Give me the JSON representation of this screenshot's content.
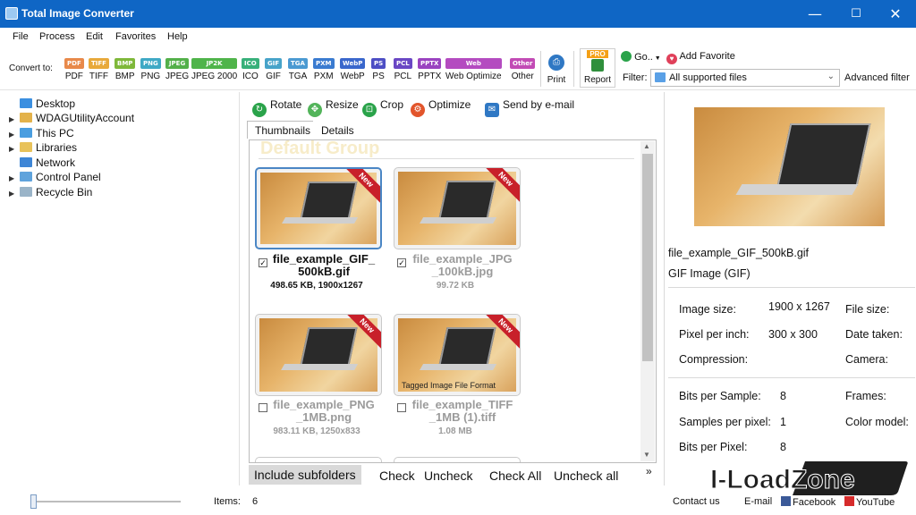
{
  "window": {
    "title": "Total Image Converter",
    "minimize": "—",
    "maximize": "☐",
    "close": "✕"
  },
  "menu": [
    "File",
    "Process",
    "Edit",
    "Favorites",
    "Help"
  ],
  "toolbar": {
    "convert_to": "Convert to:",
    "formats": [
      {
        "chip": "PDF",
        "label": "PDF",
        "color": "#e8894a"
      },
      {
        "chip": "TIFF",
        "label": "TIFF",
        "color": "#e8a93a"
      },
      {
        "chip": "BMP",
        "label": "BMP",
        "color": "#7fb83a"
      },
      {
        "chip": "PNG",
        "label": "PNG",
        "color": "#3fa9c5"
      },
      {
        "chip": "JPEG",
        "label": "JPEG",
        "color": "#53b04a"
      },
      {
        "chip": "JP2K",
        "label": "JPEG 2000",
        "color": "#4fb44a"
      },
      {
        "chip": "ICO",
        "label": "ICO",
        "color": "#38b07a"
      },
      {
        "chip": "GIF",
        "label": "GIF",
        "color": "#47a3c9"
      },
      {
        "chip": "TGA",
        "label": "TGA",
        "color": "#4b9ad2"
      },
      {
        "chip": "PXM",
        "label": "PXM",
        "color": "#3a7bd0"
      },
      {
        "chip": "WebP",
        "label": "WebP",
        "color": "#3a67cc"
      },
      {
        "chip": "PS",
        "label": "PS",
        "color": "#4d4ec4"
      },
      {
        "chip": "PCL",
        "label": "PCL",
        "color": "#6a47c4"
      },
      {
        "chip": "PPTX",
        "label": "PPTX",
        "color": "#9a43c0"
      },
      {
        "chip": "Web",
        "label": "Web Optimize",
        "color": "#b44bc0"
      },
      {
        "chip": "Other",
        "label": "Other",
        "color": "#c24bb5"
      }
    ],
    "print": "Print",
    "pro_badge": "PRO",
    "report": "Report",
    "go": "Go..",
    "add_favorite": "Add Favorite",
    "filter_label": "Filter:",
    "filter_value": "All supported files",
    "advanced_filter": "Advanced filter"
  },
  "tree": [
    "Desktop",
    "WDAGUtilityAccount",
    "This PC",
    "Libraries",
    "Network",
    "Control Panel",
    "Recycle Bin"
  ],
  "actions": [
    "Rotate",
    "Resize",
    "Crop",
    "Optimize",
    "Send by e-mail"
  ],
  "tabs": [
    "Thumbnails",
    "Details"
  ],
  "group_title": "Default Group",
  "ribbon": "New",
  "thumbnails": [
    {
      "line1": "file_example_GIF_",
      "line2": "500kB.gif",
      "meta": "498.65 KB, 1900x1267",
      "checked": true
    },
    {
      "line1": "file_example_JPG",
      "line2": "_100kB.jpg",
      "meta": "99.72 KB",
      "checked": true
    },
    {
      "line1": "file_example_PNG",
      "line2": "_1MB.png",
      "meta": "983.11 KB, 1250x833",
      "checked": false
    },
    {
      "line1": "file_example_TIFF",
      "line2": "_1MB (1).tiff",
      "meta": "1.08 MB",
      "checked": false,
      "overlay": "Tagged Image File Format"
    }
  ],
  "bottom_bar": {
    "include": "Include subfolders",
    "check": "Check",
    "uncheck": "Uncheck",
    "check_all": "Check All",
    "uncheck_all": "Uncheck all",
    "more": "»"
  },
  "preview": {
    "filename": "file_example_GIF_500kB.gif",
    "filetype": "GIF Image (GIF)",
    "props": {
      "image_size_label": "Image size:",
      "image_size": "1900 x 1267",
      "file_size_label": "File size:",
      "ppi_label": "Pixel per inch:",
      "ppi": "300 x 300",
      "date_taken_label": "Date taken:",
      "compression_label": "Compression:",
      "camera_label": "Camera:",
      "bits_sample_label": "Bits per Sample:",
      "bits_sample": "8",
      "frames_label": "Frames:",
      "samples_pixel_label": "Samples per pixel:",
      "samples_pixel": "1",
      "color_model_label": "Color model:",
      "bits_pixel_label": "Bits per Pixel:",
      "bits_pixel": "8"
    }
  },
  "status": {
    "items_label": "Items:",
    "items_count": "6",
    "zoom_level": 0.0,
    "contact": "Contact us",
    "email": "E-mail",
    "facebook": "Facebook",
    "youtube": "YouTube"
  },
  "logo": {
    "text": "I-LoadZone"
  }
}
